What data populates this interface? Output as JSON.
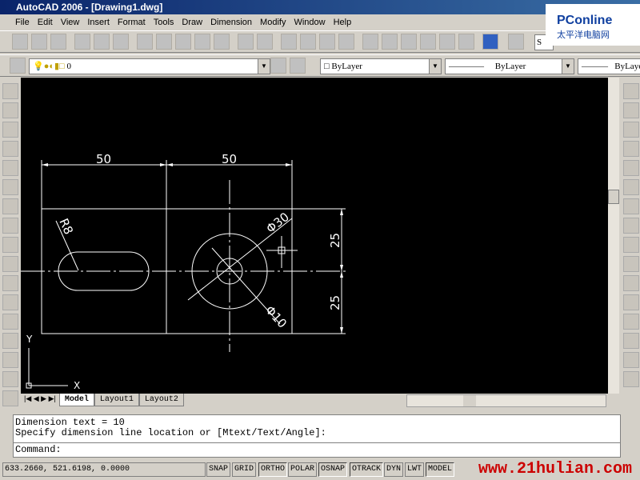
{
  "window": {
    "title": "AutoCAD 2006 - [Drawing1.dwg]"
  },
  "menu": [
    "File",
    "Edit",
    "View",
    "Insert",
    "Format",
    "Tools",
    "Draw",
    "Dimension",
    "Modify",
    "Window",
    "Help"
  ],
  "layers": {
    "current_layer": "0",
    "color": "ByLayer",
    "linetype": "ByLayer",
    "lineweight": "ByLayer"
  },
  "style_box": "S",
  "watermark_top": {
    "brand": "PConline",
    "sub": "太平洋电脑网"
  },
  "drawing": {
    "dims": [
      "50",
      "50",
      "25",
      "25"
    ],
    "radius": "R8",
    "dia_outer": "Φ30",
    "dia_inner": "Φ10",
    "ucs_x": "X",
    "ucs_y": "Y"
  },
  "tabs": [
    "Model",
    "Layout1",
    "Layout2"
  ],
  "command": {
    "lines": [
      "Dimension text = 10",
      "Specify dimension line location or [Mtext/Text/Angle]:"
    ],
    "prompt": "Command:"
  },
  "status": {
    "coords": "633.2660, 521.6198, 0.0000",
    "toggles": [
      "SNAP",
      "GRID",
      "ORTHO",
      "POLAR",
      "OSNAP",
      "OTRACK",
      "DYN",
      "LWT",
      "MODEL"
    ],
    "on": [
      "ORTHO",
      "OSNAP",
      "OTRACK",
      "MODEL"
    ]
  },
  "watermark_bottom": "www.21hulian.com",
  "colors": {
    "title": "#0a246a",
    "canvas": "#000000",
    "watermark": "#cc0000"
  }
}
